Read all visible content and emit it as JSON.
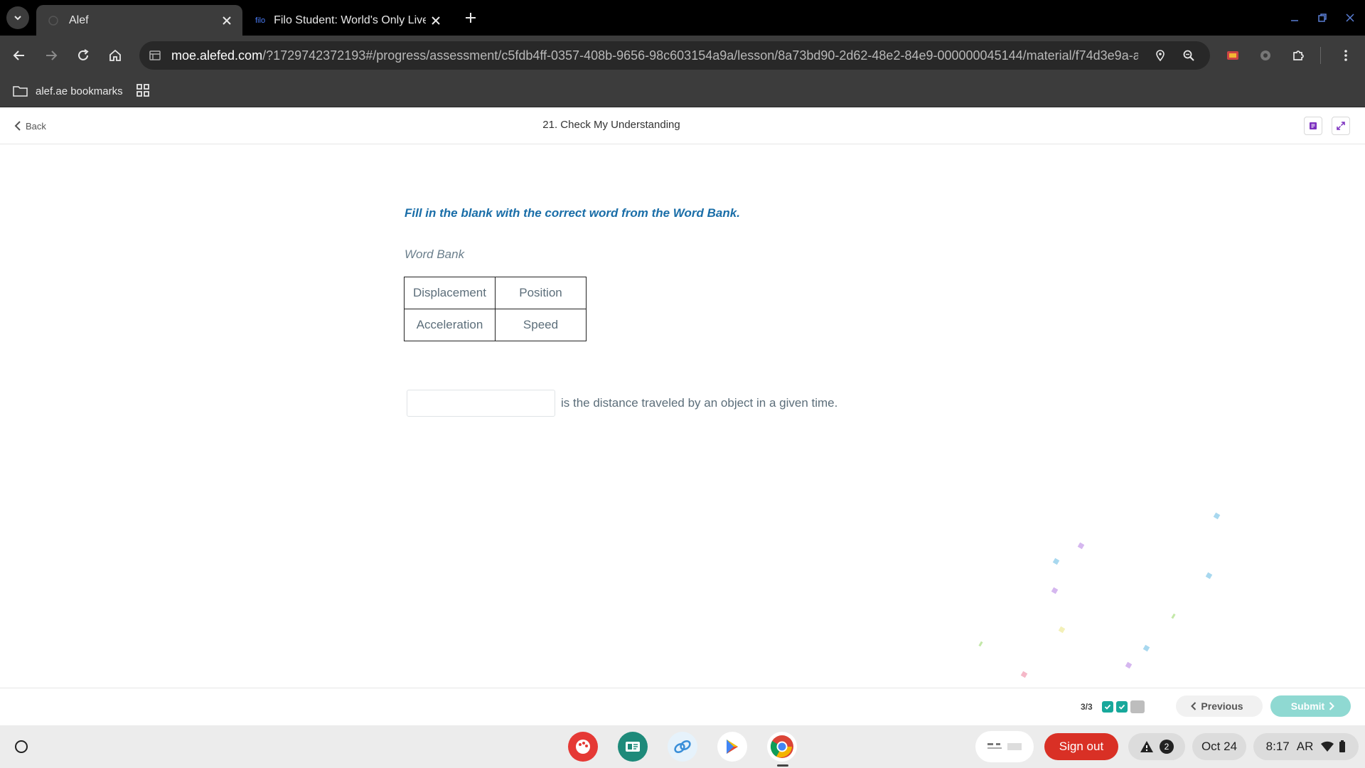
{
  "browser": {
    "tabs": [
      {
        "title": "Alef",
        "active": true
      },
      {
        "title": "Filo Student: World's Only Live I",
        "favicon_text": "filo",
        "active": false
      }
    ],
    "url_host": "moe.alefed.com",
    "url_rest": "/?1729742372193#/progress/assessment/c5fdb4ff-0357-408b-9656-98c603154a9a/lesson/8a73bd90-2d62-48e2-84e9-000000045144/material/f74d3e9a-a...",
    "bookmarks": {
      "folder_label": "alef.ae bookmarks"
    }
  },
  "header": {
    "back_label": "Back",
    "title": "21. Check My Understanding"
  },
  "question": {
    "instruction": "Fill in the blank with the correct word from the Word Bank.",
    "word_bank_label": "Word Bank",
    "word_bank": [
      [
        "Displacement",
        "Position"
      ],
      [
        "Acceleration",
        "Speed"
      ]
    ],
    "answer_value": "",
    "sentence_rest": "is the distance traveled by an object in a given time."
  },
  "footer": {
    "progress": "3/3",
    "previous_label": "Previous",
    "submit_label": "Submit"
  },
  "shelf": {
    "signout_label": "Sign out",
    "notification_count": "2",
    "date": "Oct 24",
    "time": "8:17",
    "ime": "AR"
  },
  "colors": {
    "accent": "#1a6ea8",
    "submit": "#8fd9d2",
    "progress_done": "#17a89b",
    "signout": "#d93025"
  }
}
